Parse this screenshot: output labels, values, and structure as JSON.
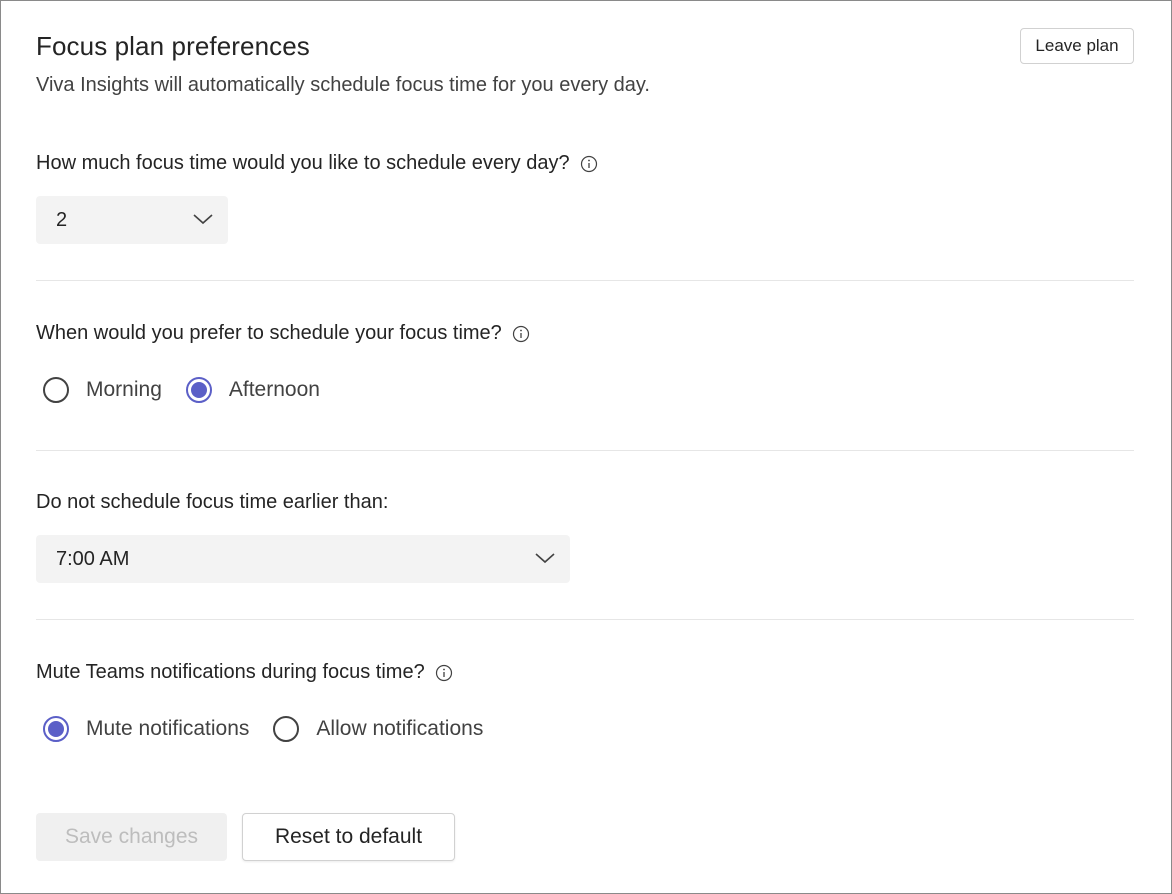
{
  "header": {
    "title": "Focus plan preferences",
    "subtitle": "Viva Insights will automatically schedule focus time for you every day.",
    "leave_label": "Leave plan"
  },
  "hours_section": {
    "question": "How much focus time would you like to schedule every day?",
    "selected_value": "2"
  },
  "time_section": {
    "question": "When would you prefer to schedule your focus time?",
    "options": [
      {
        "label": "Morning",
        "checked": false
      },
      {
        "label": "Afternoon",
        "checked": true
      }
    ]
  },
  "earliest_section": {
    "question": "Do not schedule focus time earlier than:",
    "selected_value": "7:00 AM"
  },
  "mute_section": {
    "question": "Mute Teams notifications during focus time?",
    "options": [
      {
        "label": "Mute notifications",
        "checked": true
      },
      {
        "label": "Allow notifications",
        "checked": false
      }
    ]
  },
  "footer": {
    "save_label": "Save changes",
    "reset_label": "Reset to default"
  },
  "colors": {
    "accent": "#5b5fc7",
    "disabled_text": "#bdbdbd"
  }
}
